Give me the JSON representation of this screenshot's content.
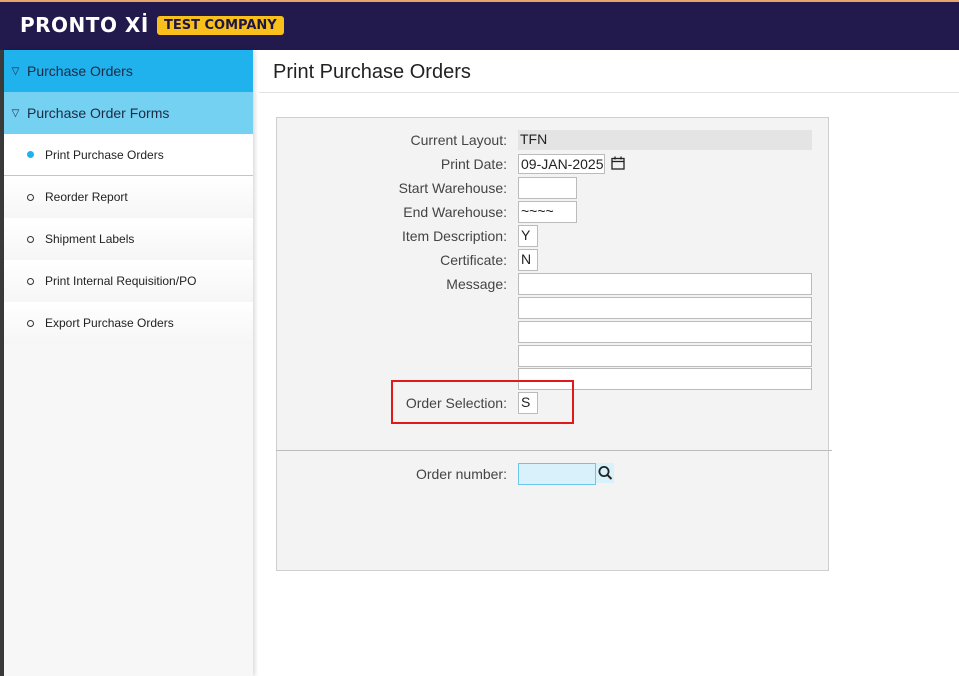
{
  "header": {
    "logo": "PRONTO Xİ",
    "company": "TEST COMPANY"
  },
  "sidebar": {
    "group1": "Purchase Orders",
    "group2": "Purchase Order Forms",
    "items": [
      {
        "label": "Print Purchase Orders",
        "active": true
      },
      {
        "label": "Reorder Report",
        "active": false
      },
      {
        "label": "Shipment Labels",
        "active": false
      },
      {
        "label": "Print Internal Requisition/PO",
        "active": false
      },
      {
        "label": "Export Purchase Orders",
        "active": false
      }
    ]
  },
  "page": {
    "title": "Print Purchase Orders"
  },
  "form": {
    "current_layout": {
      "label": "Current Layout:",
      "value": "TFN"
    },
    "print_date": {
      "label": "Print Date:",
      "value": "09-JAN-2025"
    },
    "start_warehouse": {
      "label": "Start Warehouse:",
      "value": ""
    },
    "end_warehouse": {
      "label": "End Warehouse:",
      "value": "~~~~"
    },
    "item_description": {
      "label": "Item Description:",
      "value": "Y"
    },
    "certificate": {
      "label": "Certificate:",
      "value": "N"
    },
    "message": {
      "label": "Message:",
      "lines": [
        "",
        "",
        "",
        "",
        ""
      ]
    },
    "order_selection": {
      "label": "Order Selection:",
      "value": "S"
    },
    "order_number": {
      "label": "Order number:",
      "value": ""
    }
  },
  "colors": {
    "header_bg": "#221a4d",
    "badge": "#f9c01b",
    "nav_level1": "#1fb2ec",
    "nav_level2": "#74d1f2",
    "highlight": "#e0191b"
  }
}
